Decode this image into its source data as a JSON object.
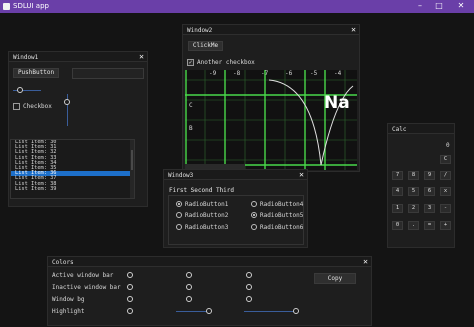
{
  "app": {
    "title": "SDLUI app",
    "minimize": "–",
    "maximize": "□",
    "close": "✕"
  },
  "window1": {
    "title": "Window1",
    "close": "✕",
    "push_button": "PushButton",
    "checkbox_label": "Checkbox",
    "list_items": [
      "List Item: 30",
      "List Item: 31",
      "List Item: 32",
      "List Item: 33",
      "List Item: 34",
      "List Item: 35",
      "List Item: 36",
      "List Item: 37",
      "List Item: 38",
      "List Item: 39"
    ],
    "selected_item": "List Item: 36"
  },
  "window2": {
    "title": "Window2",
    "close": "✕",
    "click_button": "ClickMe",
    "checkbox_label": "Another checkbox",
    "checkbox_mark": "✓",
    "ruler_ticks": [
      "-9",
      "-8",
      "-7",
      "-6",
      "-5",
      "-4"
    ],
    "row_labels": [
      "C",
      "B"
    ],
    "big_text": "Na"
  },
  "window3": {
    "title": "Window3",
    "close": "✕",
    "tabs": "First Second Third",
    "radios": [
      "RadioButton1",
      "RadioButton2",
      "RadioButton3",
      "RadioButton4",
      "RadioButton5",
      "RadioButton6"
    ],
    "selected": [
      "RadioButton1",
      "RadioButton5"
    ]
  },
  "calc": {
    "title": "Calc",
    "display": "0",
    "clear": "C",
    "keys": [
      "7",
      "8",
      "9",
      "/",
      "4",
      "5",
      "6",
      "x",
      "1",
      "2",
      "3",
      "-",
      "0",
      ".",
      "=",
      "+"
    ]
  },
  "colors": {
    "title": "Colors",
    "close": "✕",
    "rows": [
      "Active window bar",
      "Inactive window bar",
      "Window bg",
      "Highlight"
    ],
    "copy_button": "Copy"
  },
  "palette": {
    "titlebar": "#6a3fa8",
    "selection": "#1d6fc9",
    "graph_line": "#49d94a"
  }
}
